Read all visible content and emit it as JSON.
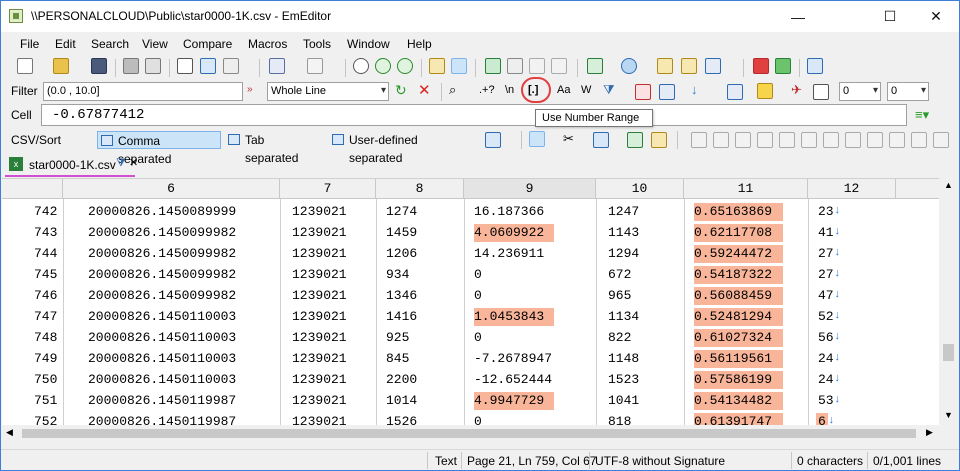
{
  "window": {
    "title": "\\\\PERSONALCLOUD\\Public\\star0000-1K.csv - EmEditor",
    "minimize": "—",
    "maximize": "☐",
    "close": "✕"
  },
  "menu": [
    "File",
    "Edit",
    "Search",
    "View",
    "Compare",
    "Macros",
    "Tools",
    "Window",
    "Help"
  ],
  "filter": {
    "label": "Filter",
    "value": "(0.0 , 10.0]",
    "scope": "Whole Line",
    "num1": "0",
    "num2": "0",
    "regex_marks": [
      ".+?",
      "\\n",
      "[.]",
      "Aa",
      "W"
    ]
  },
  "cell": {
    "label": "Cell",
    "value": "-0.67877412"
  },
  "tooltip": "Use Number Range",
  "csv": {
    "label": "CSV/Sort",
    "comma": "Comma separated",
    "tab": "Tab separated",
    "user": "User-defined separated"
  },
  "doc_tab": "star0000-1K.csv",
  "grid": {
    "columns": [
      "6",
      "7",
      "8",
      "9",
      "10",
      "11",
      "12"
    ],
    "rows": [
      {
        "n": "742",
        "c6": "20000826.1450089999",
        "c7": "1239021",
        "c8": "1274",
        "c9": "16.187366",
        "c10": "1247",
        "c11": "0.65163869",
        "c12": "23"
      },
      {
        "n": "743",
        "c6": "20000826.1450099982",
        "c7": "1239021",
        "c8": "1459",
        "c9": "4.0609922",
        "c10": "1143",
        "c11": "0.62117708",
        "c12": "41"
      },
      {
        "n": "744",
        "c6": "20000826.1450099982",
        "c7": "1239021",
        "c8": "1206",
        "c9": "14.236911",
        "c10": "1294",
        "c11": "0.59244472",
        "c12": "27"
      },
      {
        "n": "745",
        "c6": "20000826.1450099982",
        "c7": "1239021",
        "c8": "934",
        "c9": "0",
        "c10": "672",
        "c11": "0.54187322",
        "c12": "27"
      },
      {
        "n": "746",
        "c6": "20000826.1450099982",
        "c7": "1239021",
        "c8": "1346",
        "c9": "0",
        "c10": "965",
        "c11": "0.56088459",
        "c12": "47"
      },
      {
        "n": "747",
        "c6": "20000826.1450110003",
        "c7": "1239021",
        "c8": "1416",
        "c9": "1.0453843",
        "c10": "1134",
        "c11": "0.52481294",
        "c12": "52"
      },
      {
        "n": "748",
        "c6": "20000826.1450110003",
        "c7": "1239021",
        "c8": "925",
        "c9": "0",
        "c10": "822",
        "c11": "0.61027324",
        "c12": "56"
      },
      {
        "n": "749",
        "c6": "20000826.1450110003",
        "c7": "1239021",
        "c8": "845",
        "c9": "-7.2678947",
        "c10": "1148",
        "c11": "0.56119561",
        "c12": "24"
      },
      {
        "n": "750",
        "c6": "20000826.1450110003",
        "c7": "1239021",
        "c8": "2200",
        "c9": "-12.652444",
        "c10": "1523",
        "c11": "0.57586199",
        "c12": "24"
      },
      {
        "n": "751",
        "c6": "20000826.1450119987",
        "c7": "1239021",
        "c8": "1014",
        "c9": "4.9947729",
        "c10": "1041",
        "c11": "0.54134482",
        "c12": "53"
      },
      {
        "n": "752",
        "c6": "20000826.1450119987",
        "c7": "1239021",
        "c8": "1526",
        "c9": "0",
        "c10": "818",
        "c11": "0.61391747",
        "c12": "6"
      }
    ],
    "highlight_color": "#f8b599"
  },
  "status": {
    "mode": "Text",
    "position": "Page 21, Ln 759, Col 67",
    "encoding": "UTF-8 without Signature",
    "selection": "0 characters",
    "lines": "0/1,001 lines"
  },
  "colors": {
    "accent": "#2e7bd6",
    "highlight": "#f8b599",
    "tab_underline": "#d14fd1",
    "callout": "#e04040"
  }
}
